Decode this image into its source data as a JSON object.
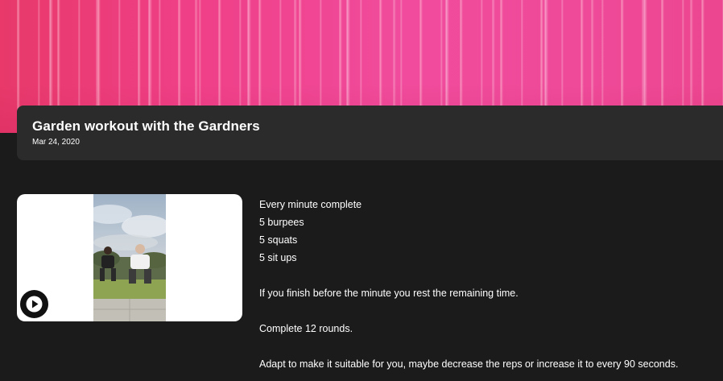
{
  "workout": {
    "title": "Garden workout with the Gardners",
    "date": "Mar 24, 2020"
  },
  "video": {
    "play_icon": "play-icon"
  },
  "description": {
    "lines": [
      "Every minute complete",
      "5 burpees",
      "5 squats",
      "5 sit ups"
    ],
    "rest_note": "If you finish before the minute you rest the remaining time.",
    "rounds": "Complete 12 rounds.",
    "adapt_note": "Adapt to make it suitable for you, maybe decrease the reps or increase it to every 90 seconds."
  },
  "colors": {
    "background": "#1b1b1b",
    "card": "#2b2b2b",
    "hero_pink": "#ef4a9a"
  }
}
